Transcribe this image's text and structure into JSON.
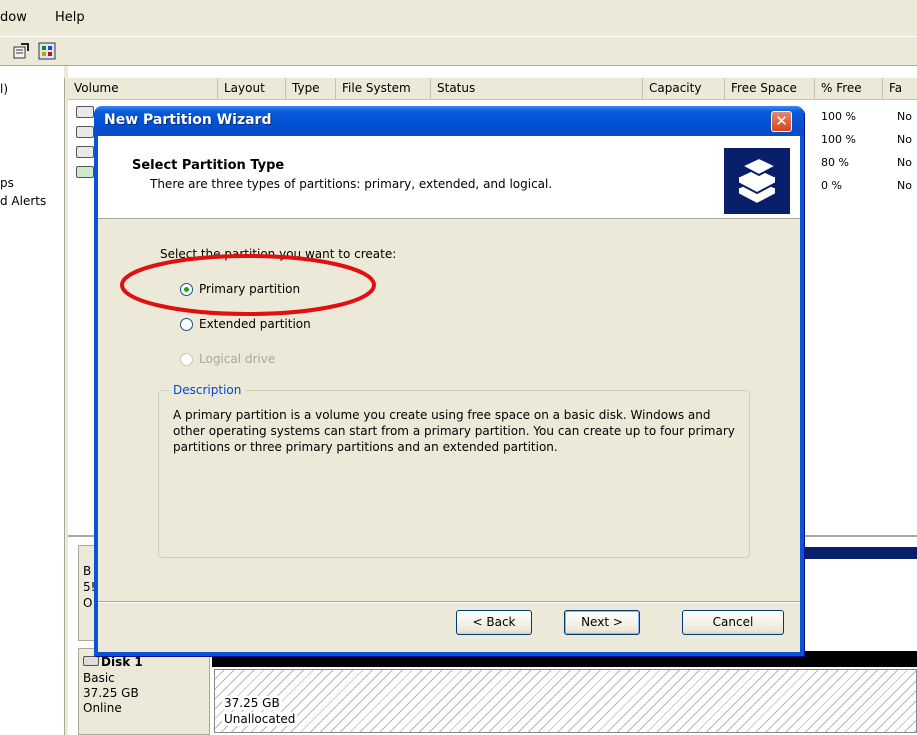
{
  "menu": {
    "window_label": "dow",
    "help_label": "Help"
  },
  "tree": {
    "item0": "l)",
    "item1": "ps",
    "item2": "d Alerts"
  },
  "volume_list": {
    "columns": [
      "Volume",
      "Layout",
      "Type",
      "File System",
      "Status",
      "Capacity",
      "Free Space",
      "% Free",
      "Fa"
    ],
    "rows": [
      {
        "pct_free": "100 %",
        "fault": "No"
      },
      {
        "pct_free": "100 %",
        "fault": "No"
      },
      {
        "pct_free": "80 %",
        "fault": "No"
      },
      {
        "pct_free": "0 %",
        "fault": "No"
      }
    ]
  },
  "disks": {
    "disk0": {
      "line1": "B",
      "line2": "5!",
      "line3": "O"
    },
    "disk1": {
      "name": "Disk 1",
      "type": "Basic",
      "size": "37.25 GB",
      "status": "Online",
      "region_size": "37.25 GB",
      "region_status": "Unallocated"
    }
  },
  "dialog": {
    "title": "New Partition Wizard",
    "close_glyph": "✕",
    "header_title": "Select Partition Type",
    "header_subtitle": "There are three types of partitions: primary, extended, and logical.",
    "prompt": "Select the partition you want to create:",
    "options": [
      {
        "label": "Primary partition",
        "selected": true,
        "enabled": true
      },
      {
        "label": "Extended partition",
        "selected": false,
        "enabled": true
      },
      {
        "label": "Logical drive",
        "selected": false,
        "enabled": false
      }
    ],
    "description_legend": "Description",
    "description_text": "A primary partition is a volume you create using free space on a basic disk. Windows and other operating systems can start from a primary partition. You can create up to four primary partitions or three primary partitions and an extended partition.",
    "buttons": {
      "back": "< Back",
      "next": "Next >",
      "cancel": "Cancel"
    }
  },
  "colors": {
    "title_blue": "#0350d4",
    "close_red": "#d5441c",
    "annotation_red": "#e01010",
    "dialog_face": "#ece9d8"
  },
  "icons": [
    "properties-icon",
    "help-icon",
    "disk-icon",
    "wizard-disks-icon",
    "radio-icon"
  ]
}
